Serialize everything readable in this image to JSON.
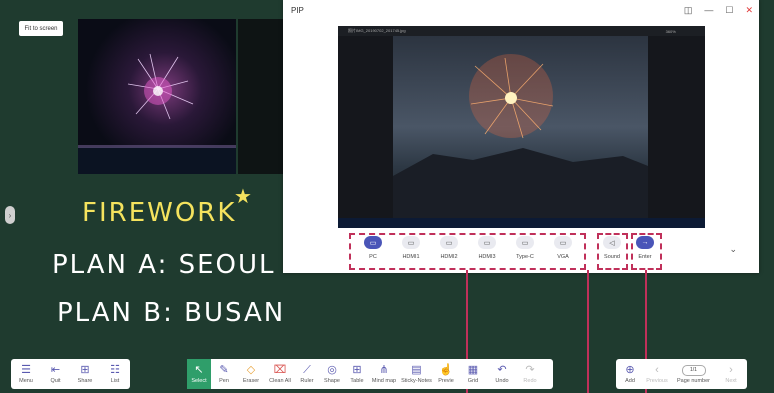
{
  "board": {
    "fit_label": "Fit to screen",
    "handwriting": [
      "FIREWORK",
      "PLAN A: SEOUL",
      "PLAN B: BUSAN"
    ]
  },
  "pip": {
    "title": "PIP",
    "video_filename": "照片IMG_20190702_201745.jpg",
    "zoom": "360%",
    "sources": [
      {
        "label": "PC",
        "icon": "pc-icon",
        "active": true
      },
      {
        "label": "HDMI1",
        "icon": "hdmi-icon",
        "active": false
      },
      {
        "label": "HDMI2",
        "icon": "hdmi-icon",
        "active": false
      },
      {
        "label": "HDMI3",
        "icon": "hdmi-icon",
        "active": false
      },
      {
        "label": "Type-C",
        "icon": "usb-c-icon",
        "active": false
      },
      {
        "label": "VGA",
        "icon": "vga-icon",
        "active": false
      }
    ],
    "sound_label": "Sound",
    "enter_label": "Enter"
  },
  "toolbar_left": [
    {
      "label": "Menu",
      "icon": "menu-icon"
    },
    {
      "label": "Quit",
      "icon": "quit-icon"
    },
    {
      "label": "Share",
      "icon": "share-icon"
    },
    {
      "label": "List",
      "icon": "list-icon"
    }
  ],
  "toolbar_center": [
    {
      "label": "Select",
      "icon": "select-icon"
    },
    {
      "label": "Pen",
      "icon": "pen-icon"
    },
    {
      "label": "Eraser",
      "icon": "eraser-icon"
    },
    {
      "label": "Clean All",
      "icon": "clean-all-icon"
    },
    {
      "label": "Ruler",
      "icon": "ruler-icon"
    },
    {
      "label": "Shape",
      "icon": "shape-icon"
    },
    {
      "label": "Table",
      "icon": "table-icon"
    },
    {
      "label": "Mind map",
      "icon": "mind-map-icon"
    },
    {
      "label": "Sticky-Notes",
      "icon": "sticky-notes-icon"
    },
    {
      "label": "Previe",
      "icon": "preview-icon"
    },
    {
      "label": "Grid",
      "icon": "grid-icon"
    },
    {
      "label": "Undo",
      "icon": "undo-icon"
    },
    {
      "label": "Redo",
      "icon": "redo-icon"
    }
  ],
  "toolbar_right": {
    "add_label": "Add",
    "previous_label": "Previous",
    "page_value": "1/1",
    "page_number_label": "Page number",
    "next_label": "Next"
  },
  "colors": {
    "board": "#1f3b2f",
    "select_active": "#2f9e6a",
    "highlight_dash": "#c0305a",
    "source_active": "#4a55b8"
  }
}
